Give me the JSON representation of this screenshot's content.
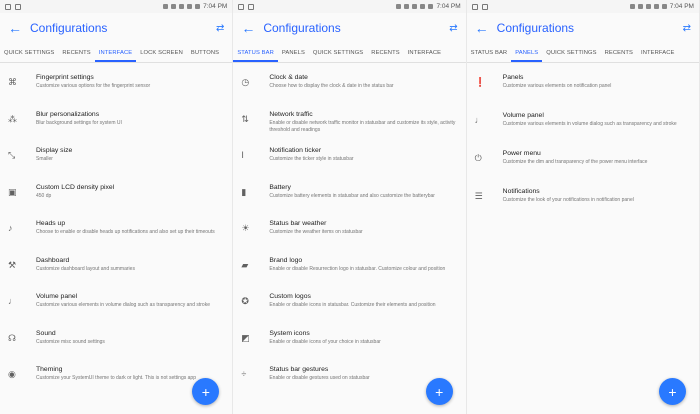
{
  "time": "7:04 PM",
  "title": "Configurations",
  "icons": {
    "back": "arrow-back-icon",
    "swap": "swap-horiz-icon",
    "fab": "plus-icon"
  },
  "accent": "#2962ff",
  "panels": [
    {
      "tabs": [
        "QUICK SETTINGS",
        "RECENTS",
        "INTERFACE",
        "LOCK SCREEN",
        "BUTTONS"
      ],
      "active": 2,
      "items": [
        {
          "icon": "fingerprint-icon",
          "glyph": "⌘",
          "title": "Fingerprint settings",
          "sub": "Customize various options for the fingerprint sensor"
        },
        {
          "icon": "blur-icon",
          "glyph": "⁂",
          "title": "Blur personalizations",
          "sub": "Blur background settings for system UI"
        },
        {
          "icon": "display-size-icon",
          "glyph": "⤡",
          "title": "Display size",
          "sub": "Smaller"
        },
        {
          "icon": "lcd-density-icon",
          "glyph": "▣",
          "title": "Custom LCD density pixel",
          "sub": "450 dp"
        },
        {
          "icon": "heads-up-icon",
          "glyph": "♪",
          "title": "Heads up",
          "sub": "Choose to enable or disable heads up notifications and also set up their timeouts"
        },
        {
          "icon": "dashboard-icon",
          "glyph": "⚒",
          "title": "Dashboard",
          "sub": "Customize dashboard layout and summaries"
        },
        {
          "icon": "volume-panel-icon",
          "glyph": "♩",
          "title": "Volume panel",
          "sub": "Customize various elements in volume dialog such as transparency and stroke"
        },
        {
          "icon": "headphones-icon",
          "glyph": "☊",
          "title": "Sound",
          "sub": "Customize misc sound settings"
        },
        {
          "icon": "theming-icon",
          "glyph": "◉",
          "title": "Theming",
          "sub": "Customize your SystemUI theme to dark or light. This is not settings app"
        }
      ]
    },
    {
      "tabs": [
        "STATUS BAR",
        "PANELS",
        "QUICK SETTINGS",
        "RECENTS",
        "INTERFACE"
      ],
      "active": 0,
      "items": [
        {
          "icon": "clock-icon",
          "glyph": "◷",
          "title": "Clock & date",
          "sub": "Choose how to display the clock & date in the status bar"
        },
        {
          "icon": "network-traffic-icon",
          "glyph": "⇅",
          "title": "Network traffic",
          "sub": "Enable or disable network traffic monitor in statusbar and customize its style, activity threshold and readings"
        },
        {
          "icon": "ticker-icon",
          "glyph": "I",
          "title": "Notification ticker",
          "sub": "Customize the ticker style in statusbar"
        },
        {
          "icon": "battery-icon",
          "glyph": "▮",
          "title": "Battery",
          "sub": "Customize battery elements in statusbar and also customize the batterybar"
        },
        {
          "icon": "weather-icon",
          "glyph": "☀",
          "title": "Status bar weather",
          "sub": "Customize the weather items on statusbar"
        },
        {
          "icon": "brand-logo-icon",
          "glyph": "▰",
          "title": "Brand logo",
          "sub": "Enable or disable Resurrection logo in statusbar. Customize colour and position"
        },
        {
          "icon": "custom-logos-icon",
          "glyph": "✪",
          "title": "Custom logos",
          "sub": "Enable or disable icons in statusbar. Customize their elements and position"
        },
        {
          "icon": "system-icons-icon",
          "glyph": "◩",
          "title": "System icons",
          "sub": "Enable or disable icons of your choice in statusbar"
        },
        {
          "icon": "gestures-icon",
          "glyph": "÷",
          "title": "Status bar gestures",
          "sub": "Enable or disable gestures used on statusbar"
        }
      ]
    },
    {
      "tabs": [
        "STATUS BAR",
        "PANELS",
        "QUICK SETTINGS",
        "RECENTS",
        "INTERFACE"
      ],
      "active": 1,
      "items": [
        {
          "icon": "panels-icon",
          "glyph": "❗",
          "title": "Panels",
          "sub": "Customize various elements on notification panel"
        },
        {
          "icon": "volume-panel-icon",
          "glyph": "♩",
          "title": "Volume panel",
          "sub": "Customize various elements in volume dialog such as transparency and stroke"
        },
        {
          "icon": "power-icon",
          "glyph": "⏻",
          "title": "Power menu",
          "sub": "Customize the dim and transparency of the power menu interface"
        },
        {
          "icon": "notifications-icon",
          "glyph": "☰",
          "title": "Notifications",
          "sub": "Customize the look of your notifications in notification panel"
        }
      ]
    }
  ]
}
